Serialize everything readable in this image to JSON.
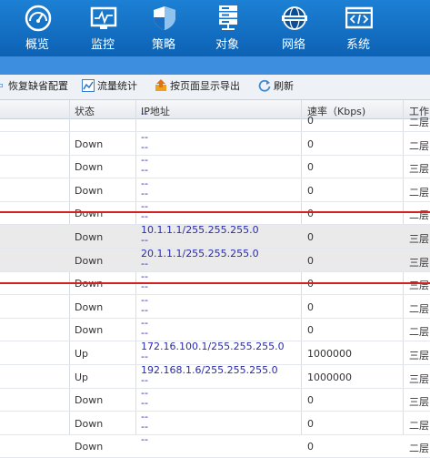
{
  "nav": [
    {
      "label": "概览",
      "icon": "dashboard-gauge-icon"
    },
    {
      "label": "监控",
      "icon": "monitor-icon"
    },
    {
      "label": "策略",
      "icon": "shield-icon"
    },
    {
      "label": "对象",
      "icon": "server-rack-icon"
    },
    {
      "label": "网络",
      "icon": "network-globe-icon"
    },
    {
      "label": "系统",
      "icon": "code-window-icon"
    }
  ],
  "toolbar": {
    "restore_label": "恢复缺省配置",
    "traffic_label": "流量统计",
    "export_label": "按页面显示导出",
    "refresh_label": "刷新"
  },
  "table": {
    "headers": {
      "status": "状态",
      "ip": "IP地址",
      "speed": "速率（Kbps)",
      "mode": "工作"
    },
    "rows": [
      {
        "status": "",
        "ip1": "--",
        "ip2": "",
        "speed": "0",
        "mode": "二层"
      },
      {
        "status": "Down",
        "ip1": "--",
        "ip2": "--",
        "speed": "0",
        "mode": "二层"
      },
      {
        "status": "Down",
        "ip1": "--",
        "ip2": "--",
        "speed": "0",
        "mode": "三层"
      },
      {
        "status": "Down",
        "ip1": "--",
        "ip2": "--",
        "speed": "0",
        "mode": "二层"
      },
      {
        "status": "Down",
        "ip1": "--",
        "ip2": "--",
        "speed": "0",
        "mode": "二层"
      },
      {
        "status": "Down",
        "ip1": "10.1.1.1/255.255.255.0",
        "ip2": "--",
        "speed": "0",
        "mode": "三层"
      },
      {
        "status": "Down",
        "ip1": "20.1.1.1/255.255.255.0",
        "ip2": "--",
        "speed": "0",
        "mode": "三层"
      },
      {
        "status": "Down",
        "ip1": "--",
        "ip2": "--",
        "speed": "0",
        "mode": "三层"
      },
      {
        "status": "Down",
        "ip1": "--",
        "ip2": "--",
        "speed": "0",
        "mode": "二层"
      },
      {
        "status": "Down",
        "ip1": "--",
        "ip2": "--",
        "speed": "0",
        "mode": "二层"
      },
      {
        "status": "Up",
        "ip1": "172.16.100.1/255.255.255.0",
        "ip2": "--",
        "speed": "1000000",
        "mode": "三层"
      },
      {
        "status": "Up",
        "ip1": "192.168.1.6/255.255.255.0",
        "ip2": "--",
        "speed": "1000000",
        "mode": "三层"
      },
      {
        "status": "Down",
        "ip1": "--",
        "ip2": "--",
        "speed": "0",
        "mode": "三层"
      },
      {
        "status": "Down",
        "ip1": "--",
        "ip2": "--",
        "speed": "0",
        "mode": "二层"
      },
      {
        "status": "Down",
        "ip1": "--",
        "ip2": "",
        "speed": "0",
        "mode": "二层"
      }
    ]
  },
  "colors": {
    "nav_bg": "#1672c8",
    "highlight_line": "#d42020",
    "ip_text": "#2a2ab0"
  }
}
